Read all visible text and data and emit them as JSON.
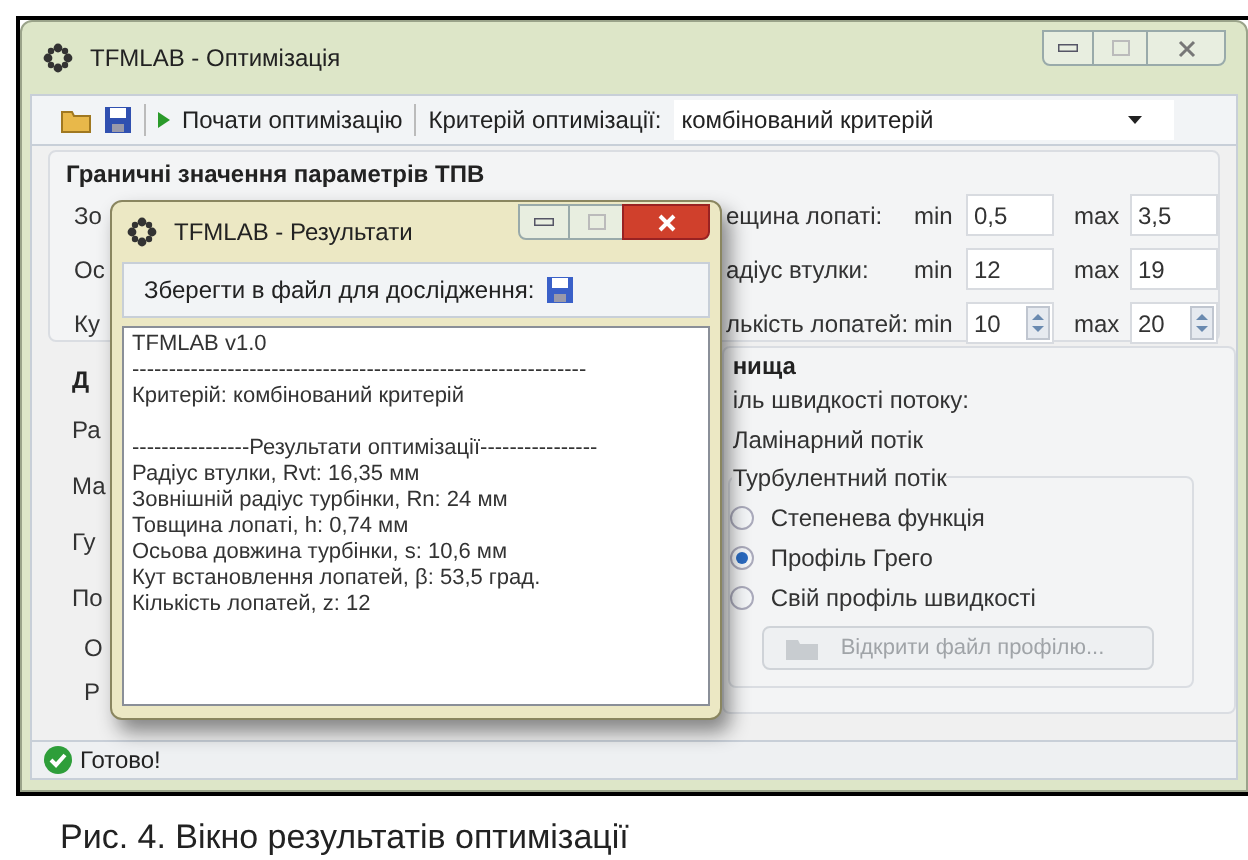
{
  "window": {
    "title": "TFMLAB - Оптимізація"
  },
  "toolbar": {
    "start_button": "Почати оптимізацію",
    "criterion_label": "Критерій оптимізації:",
    "criterion_value": "комбінований критерій"
  },
  "bounds_group": {
    "title": "Граничні значення параметрів ТПВ",
    "left_labels": [
      "Зо",
      "Ос",
      "Ку"
    ],
    "rows": [
      {
        "kind": "text",
        "label": "ещина лопаті:",
        "min_label": "min",
        "min": "0,5",
        "max_label": "max",
        "max": "3,5"
      },
      {
        "kind": "text",
        "label": "адіус втулки:",
        "min_label": "min",
        "min": "12",
        "max_label": "max",
        "max": "19"
      },
      {
        "kind": "spin",
        "label": "лькість лопатей:",
        "min_label": "min",
        "min": "10",
        "max_label": "max",
        "max": "20"
      }
    ]
  },
  "second_group": {
    "title_left": "Д",
    "title": "нища",
    "left_labels": [
      "Ра",
      "Ма",
      "Гу",
      "По"
    ],
    "inner_left_labels": [
      "О",
      "Р"
    ],
    "profile_label": "іль швидкості потоку:",
    "laminar_label": "Ламінарний потік",
    "turbulent": {
      "title": "Турбулентний потік",
      "options": [
        {
          "label": "Степенева функція",
          "selected": false
        },
        {
          "label": "Профіль Грего",
          "selected": true
        },
        {
          "label": "Свій профіль швидкості",
          "selected": false
        }
      ]
    },
    "open_button": {
      "label": "Відкрити файл профілю...",
      "disabled": true
    }
  },
  "status_bar": {
    "text": "Готово!"
  },
  "results_window": {
    "title": "TFMLAB - Результати",
    "save_label": "Зберегти в файл для дослідження:",
    "lines": [
      [
        "TFMLAB v1.0",
        "--------------------------------------------------------------",
        "Критерій: комбінований критерій"
      ],
      [
        "----------------Результати оптимізації----------------",
        "Радіус втулки, Rvt:  16,35 мм",
        "Зовнішній радіус турбінки, Rn:  24 мм",
        "Товщина лопаті, h:  0,74 мм",
        "Осьова довжина турбінки, s:  10,6 мм",
        "Кут встановлення лопатей, β:  53,5 град.",
        "Кількість лопатей, z:  12"
      ]
    ]
  },
  "caption": "Рис. 4. Вікно результатів оптимізації"
}
